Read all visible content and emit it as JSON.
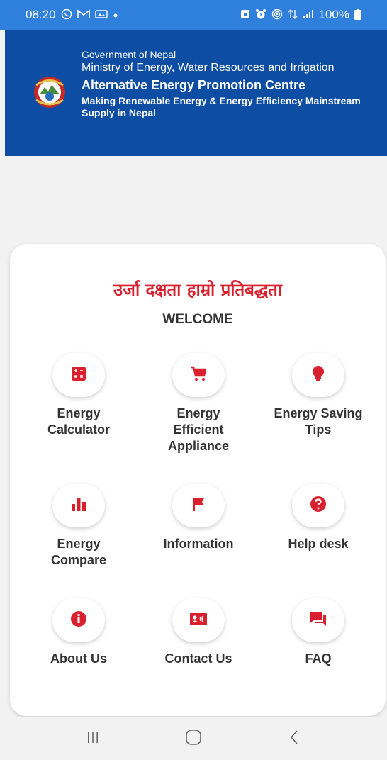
{
  "status_bar": {
    "time": "08:20",
    "battery": "100%",
    "icons_left": [
      "whatsapp-icon",
      "gmail-icon",
      "image-icon",
      "dot-icon"
    ],
    "icons_right": [
      "lock-icon",
      "alarm-icon",
      "hotspot-icon",
      "data-icon",
      "signal-icon",
      "battery-icon"
    ]
  },
  "header": {
    "gov": "Government of Nepal",
    "ministry": "Ministry of Energy, Water Resources and Irrigation",
    "org": "Alternative Energy Promotion Centre",
    "tagline": "Making Renewable Energy & Energy Efficiency Mainstream Supply in Nepal"
  },
  "card": {
    "slogan": "उर्जा दक्षता हाम्रो प्रतिबद्धता",
    "welcome": "WELCOME"
  },
  "menu": [
    {
      "label": "Energy Calculator",
      "icon": "calculator-icon"
    },
    {
      "label": "Energy Efficient Appliance",
      "icon": "cart-icon"
    },
    {
      "label": "Energy Saving Tips",
      "icon": "lightbulb-icon"
    },
    {
      "label": "Energy Compare",
      "icon": "bar-chart-icon"
    },
    {
      "label": "Information",
      "icon": "flag-icon"
    },
    {
      "label": "Help desk",
      "icon": "help-icon"
    },
    {
      "label": "About Us",
      "icon": "info-icon"
    },
    {
      "label": "Contact Us",
      "icon": "contact-card-icon"
    },
    {
      "label": "FAQ",
      "icon": "chat-icon"
    }
  ],
  "colors": {
    "status_bar": "#2f80dc",
    "header": "#0d4da3",
    "accent": "#d8202f",
    "background": "#f2f2f2"
  }
}
